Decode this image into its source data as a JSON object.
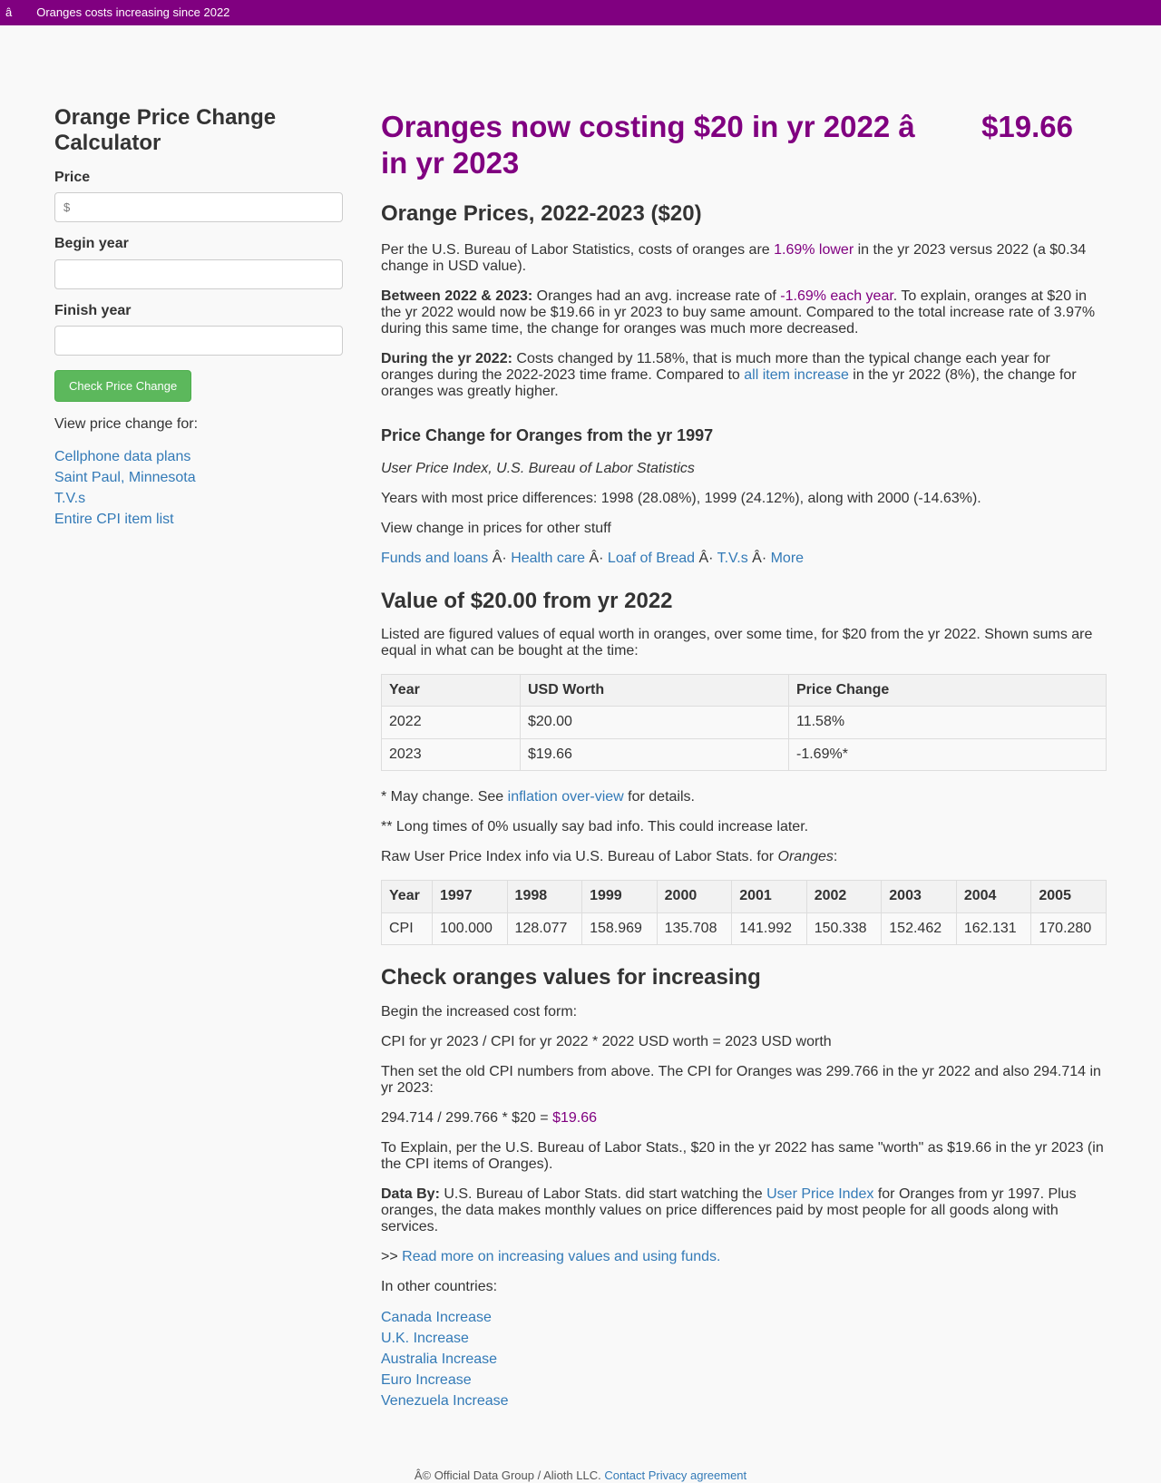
{
  "topbar": {
    "brand": "â",
    "title": "Oranges costs increasing since 2022"
  },
  "sidebar": {
    "heading": "Orange Price Change Calculator",
    "price_label": "Price",
    "price_placeholder": "$",
    "begin_label": "Begin year",
    "finish_label": "Finish year",
    "button": "Check Price Change",
    "view_for": "View price change for:",
    "links": [
      "Cellphone data plans",
      "Saint Paul, Minnesota",
      "T.V.s",
      "Entire CPI item list"
    ]
  },
  "main": {
    "h1": "Oranges now costing $20 in yr 2022 â        $19.66 in yr 2023",
    "h2_prices": "Orange Prices, 2022-2023 ($20)",
    "p1": {
      "a": "Per the U.S. Bureau of Labor Statistics, costs of oranges are ",
      "highlight": "1.69% lower",
      "b": " in the yr 2023 versus 2022 (a $0.34 change in USD value)."
    },
    "p2": {
      "bold": "Between 2022 & 2023:",
      "a": " Oranges had an avg. increase rate of ",
      "highlight": "-1.69% each year",
      "b": ". To explain, oranges at $20 in the yr 2022 would now be $19.66 in yr 2023 to buy same amount. Compared to the total increase rate of 3.97% during this same time, the change for oranges was much more decreased."
    },
    "p3": {
      "bold": "During the yr 2022:",
      "a": " Costs changed by 11.58%, that is much more than the typical change each year for oranges during the 2022-2023 time frame. Compared to ",
      "link": "all item increase",
      "b": " in the yr 2022 (8%), the change for oranges was greatly higher."
    },
    "h3_change": "Price Change for Oranges from the yr 1997",
    "cpi_source": "User Price Index, U.S. Bureau of Labor Statistics",
    "most_diff": "Years with most price differences: 1998 (28.08%), 1999 (24.12%), along with 2000 (-14.63%).",
    "view_other": "View change in prices for other stuff",
    "other_links": [
      "Funds and loans",
      "Health care",
      "Loaf of Bread",
      "T.V.s",
      "More"
    ],
    "sep": " Â· ",
    "h2_value": "Value of $20.00 from yr 2022",
    "value_desc": "Listed are figured values of equal worth in oranges, over some time, for $20 from the yr 2022. Shown sums are equal in what can be bought at the time:",
    "value_table": {
      "headers": [
        "Year",
        "USD Worth",
        "Price Change"
      ],
      "rows": [
        [
          "2022",
          "$20.00",
          "11.58%"
        ],
        [
          "2023",
          "$19.66",
          "-1.69%*"
        ]
      ]
    },
    "note1": {
      "a": "* May change. See ",
      "link": "inflation over-view",
      "b": " for details."
    },
    "note2": "** Long times of 0% usually say bad info. This could increase later.",
    "raw_cpi": {
      "a": "Raw User Price Index info via U.S. Bureau of Labor Stats. for ",
      "em": "Oranges",
      "b": ":"
    },
    "cpi_table": {
      "headers": [
        "Year",
        "1997",
        "1998",
        "1999",
        "2000",
        "2001",
        "2002",
        "2003",
        "2004",
        "2005"
      ],
      "row": [
        "CPI",
        "100.000",
        "128.077",
        "158.969",
        "135.708",
        "141.992",
        "150.338",
        "152.462",
        "162.131",
        "170.280"
      ]
    },
    "h2_check": "Check oranges values for increasing",
    "begin_form": "Begin the increased cost form:",
    "formula": "CPI for yr 2023 / CPI for yr 2022 * 2022 USD worth = 2023 USD worth",
    "then_set": "Then set the old CPI numbers from above. The CPI for Oranges was 299.766 in the yr 2022 and also 294.714 in yr 2023:",
    "calc": {
      "a": "294.714 / 299.766 * $20 = ",
      "result": "$19.66"
    },
    "explain": "To Explain, per the U.S. Bureau of Labor Stats., $20 in the yr 2022 has same \"worth\" as $19.66 in the yr 2023 (in the CPI items of Oranges).",
    "data_by": {
      "bold": "Data By:",
      "a": " U.S. Bureau of Labor Stats. did start watching the ",
      "link": "User Price Index",
      "b": " for Oranges from yr 1997. Plus oranges, the data makes monthly values on price differences paid by most people for all goods along with services."
    },
    "read_more": {
      "prefix": ">> ",
      "link": "Read more on increasing values and using funds."
    },
    "other_countries": "In other countries:",
    "country_links": [
      "Canada Increase",
      "U.K. Increase",
      "Australia Increase",
      "Euro Increase",
      "Venezuela Increase"
    ]
  },
  "footer": {
    "text": "Â© Official Data Group / Alioth LLC. ",
    "contact": "Contact",
    "privacy": "Privacy agreement"
  },
  "colors": {
    "brand": "#800080",
    "link": "#337ab7",
    "button": "#5cb85c"
  }
}
